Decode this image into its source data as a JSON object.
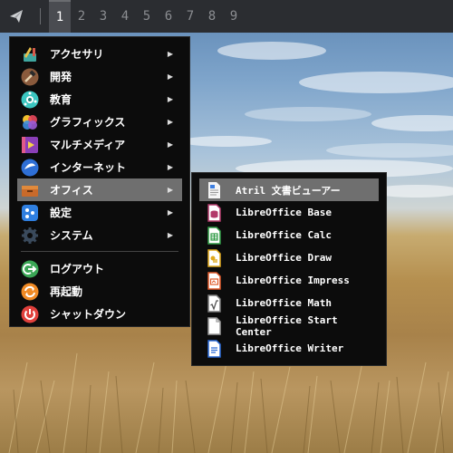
{
  "panel": {
    "workspaces": [
      "1",
      "2",
      "3",
      "4",
      "5",
      "6",
      "7",
      "8",
      "9"
    ],
    "active_workspace": "1"
  },
  "main_menu": {
    "items": [
      {
        "label": "アクセサリ",
        "icon": "accessories-icon"
      },
      {
        "label": "開発",
        "icon": "development-icon"
      },
      {
        "label": "教育",
        "icon": "education-icon"
      },
      {
        "label": "グラフィックス",
        "icon": "graphics-icon"
      },
      {
        "label": "マルチメディア",
        "icon": "multimedia-icon"
      },
      {
        "label": "インターネット",
        "icon": "internet-icon"
      },
      {
        "label": "オフィス",
        "icon": "office-icon"
      },
      {
        "label": "設定",
        "icon": "settings-icon"
      },
      {
        "label": "システム",
        "icon": "system-icon"
      }
    ],
    "actions": [
      {
        "label": "ログアウト",
        "icon": "logout-icon"
      },
      {
        "label": "再起動",
        "icon": "restart-icon"
      },
      {
        "label": "シャットダウン",
        "icon": "shutdown-icon"
      }
    ]
  },
  "office_submenu": {
    "items": [
      {
        "label": "Atril 文書ビューアー",
        "icon": "document-viewer-icon"
      },
      {
        "label": "LibreOffice Base",
        "icon": "libreoffice-base-icon"
      },
      {
        "label": "LibreOffice Calc",
        "icon": "libreoffice-calc-icon"
      },
      {
        "label": "LibreOffice Draw",
        "icon": "libreoffice-draw-icon"
      },
      {
        "label": "LibreOffice Impress",
        "icon": "libreoffice-impress-icon"
      },
      {
        "label": "LibreOffice Math",
        "icon": "libreoffice-math-icon"
      },
      {
        "label": "LibreOffice Start Center",
        "icon": "libreoffice-start-center-icon"
      },
      {
        "label": "LibreOffice Writer",
        "icon": "libreoffice-writer-icon"
      }
    ]
  },
  "colors": {
    "panel": "#2b2d31",
    "menu_bg": "#0c0c0c",
    "highlight": "#6f6f6f",
    "logout": "#3aa655",
    "restart": "#f08a24",
    "shutdown": "#e0403c"
  }
}
